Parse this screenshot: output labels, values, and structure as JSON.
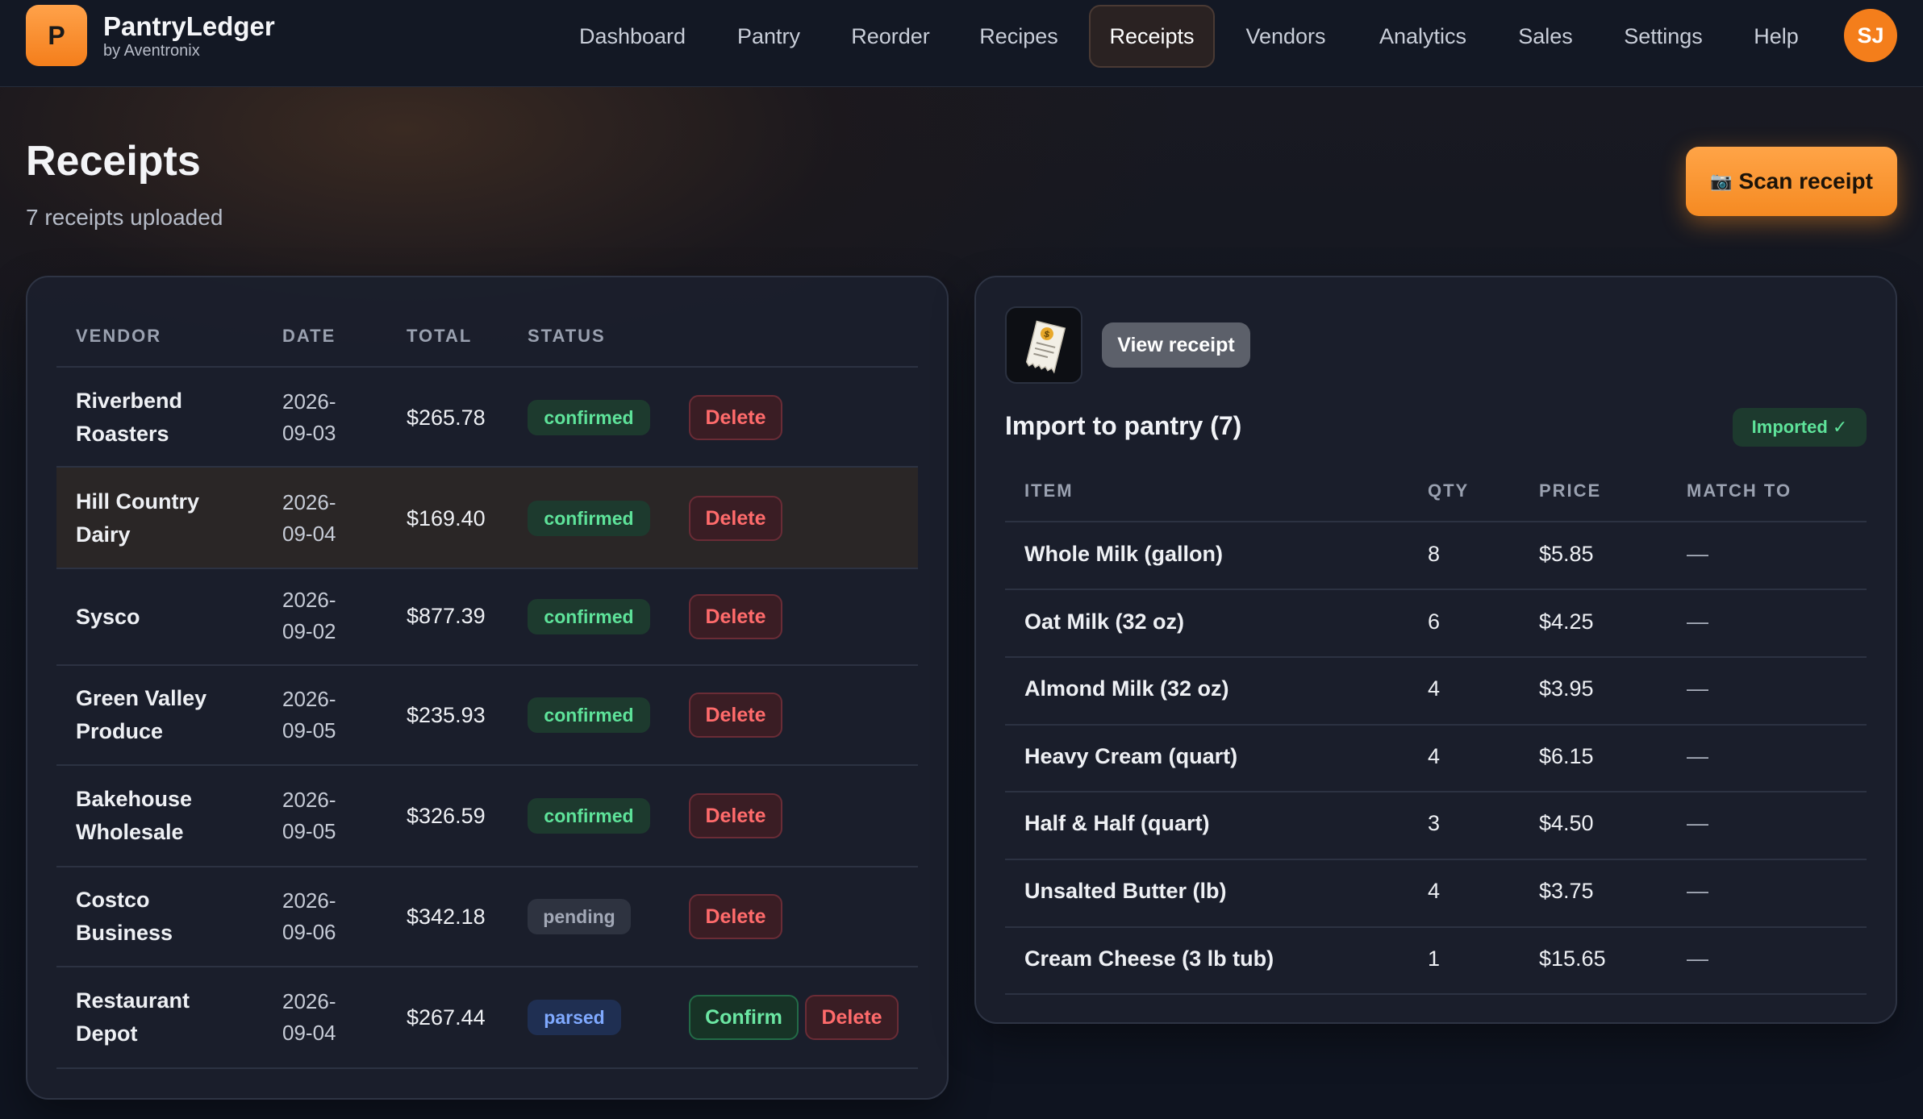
{
  "brand": {
    "logo_letter": "P",
    "name": "PantryLedger",
    "sub": "by Aventronix"
  },
  "nav": [
    {
      "label": "Dashboard",
      "active": false
    },
    {
      "label": "Pantry",
      "active": false
    },
    {
      "label": "Reorder",
      "active": false
    },
    {
      "label": "Recipes",
      "active": false
    },
    {
      "label": "Receipts",
      "active": true
    },
    {
      "label": "Vendors",
      "active": false
    },
    {
      "label": "Analytics",
      "active": false
    },
    {
      "label": "Sales",
      "active": false
    },
    {
      "label": "Settings",
      "active": false
    },
    {
      "label": "Help",
      "active": false
    }
  ],
  "user": {
    "initials": "SJ"
  },
  "header": {
    "title": "Receipts",
    "subtitle": "7 receipts uploaded",
    "scan_icon": "📷",
    "scan_label": "Scan receipt"
  },
  "receipts": {
    "columns": [
      "VENDOR",
      "DATE",
      "TOTAL",
      "STATUS"
    ],
    "rows": [
      {
        "vendor_l1": "Riverbend",
        "vendor_l2": "Roasters",
        "date_l1": "2026-",
        "date_l2": "09-03",
        "total": "$265.78",
        "status": "confirmed",
        "confirm_label": "",
        "delete_label": "Delete"
      },
      {
        "vendor_l1": "Hill Country",
        "vendor_l2": "Dairy",
        "date_l1": "2026-",
        "date_l2": "09-04",
        "total": "$169.40",
        "status": "confirmed",
        "confirm_label": "",
        "delete_label": "Delete"
      },
      {
        "vendor_l1": "Sysco",
        "vendor_l2": "",
        "date_l1": "2026-",
        "date_l2": "09-02",
        "total": "$877.39",
        "status": "confirmed",
        "confirm_label": "",
        "delete_label": "Delete"
      },
      {
        "vendor_l1": "Green Valley",
        "vendor_l2": "Produce",
        "date_l1": "2026-",
        "date_l2": "09-05",
        "total": "$235.93",
        "status": "confirmed",
        "confirm_label": "",
        "delete_label": "Delete"
      },
      {
        "vendor_l1": "Bakehouse",
        "vendor_l2": "Wholesale",
        "date_l1": "2026-",
        "date_l2": "09-05",
        "total": "$326.59",
        "status": "confirmed",
        "confirm_label": "",
        "delete_label": "Delete"
      },
      {
        "vendor_l1": "Costco",
        "vendor_l2": "Business",
        "date_l1": "2026-",
        "date_l2": "09-06",
        "total": "$342.18",
        "status": "pending",
        "confirm_label": "",
        "delete_label": "Delete"
      },
      {
        "vendor_l1": "Restaurant",
        "vendor_l2": "Depot",
        "date_l1": "2026-",
        "date_l2": "09-04",
        "total": "$267.44",
        "status": "parsed",
        "confirm_label": "Confirm",
        "delete_label": "Delete"
      }
    ]
  },
  "detail": {
    "view_label": "View receipt",
    "import_title": "Import to pantry (7)",
    "imported_badge": "Imported ✓",
    "columns": [
      "ITEM",
      "QTY",
      "PRICE",
      "MATCH TO"
    ],
    "items": [
      {
        "name": "Whole Milk (gallon)",
        "qty": "8",
        "price": "$5.85",
        "match": "—"
      },
      {
        "name": "Oat Milk (32 oz)",
        "qty": "6",
        "price": "$4.25",
        "match": "—"
      },
      {
        "name": "Almond Milk (32 oz)",
        "qty": "4",
        "price": "$3.95",
        "match": "—"
      },
      {
        "name": "Heavy Cream (quart)",
        "qty": "4",
        "price": "$6.15",
        "match": "—"
      },
      {
        "name": "Half & Half (quart)",
        "qty": "3",
        "price": "$4.50",
        "match": "—"
      },
      {
        "name": "Unsalted Butter (lb)",
        "qty": "4",
        "price": "$3.75",
        "match": "—"
      },
      {
        "name": "Cream Cheese (3 lb tub)",
        "qty": "1",
        "price": "$15.65",
        "match": "—"
      }
    ]
  }
}
